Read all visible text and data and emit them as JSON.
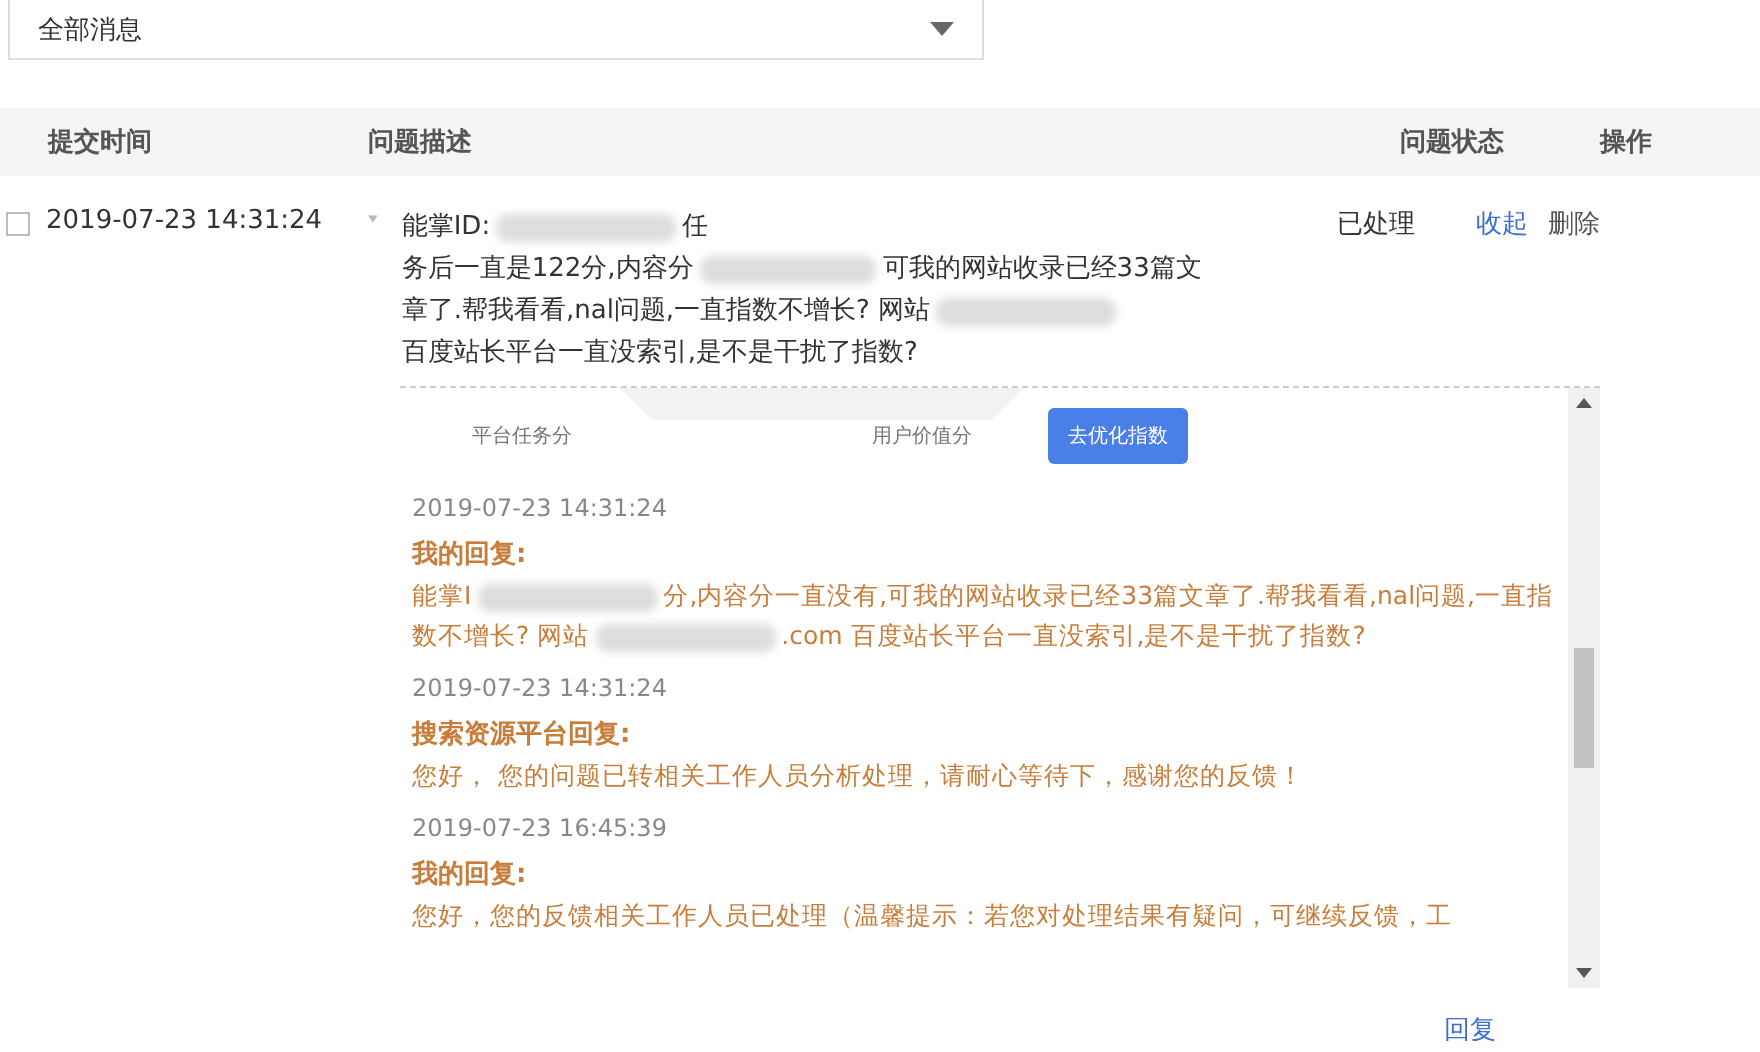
{
  "filter": {
    "value": "全部消息"
  },
  "table": {
    "columns": [
      "提交时间",
      "问题描述",
      "问题状态",
      "操作"
    ],
    "rows": [
      {
        "checked": false,
        "expanded": true,
        "time": "2019-07-23 14:31:24",
        "status": "已处理",
        "actions": [
          {
            "label": "收起",
            "kind": "link"
          },
          {
            "label": "删除",
            "kind": "plain"
          }
        ],
        "description": [
          [
            {
              "kind": "text",
              "text": "能掌ID:"
            },
            {
              "kind": "redacted"
            },
            {
              "kind": "text",
              "text": "任"
            }
          ],
          [
            {
              "kind": "text",
              "text": "务后一直是122分,内容分"
            },
            {
              "kind": "redacted"
            },
            {
              "kind": "text",
              "text": "可我的网站收录已经33篇文"
            }
          ],
          [
            {
              "kind": "text",
              "text": "章了.帮我看看,nal问题,一直指数不增长? 网站"
            },
            {
              "kind": "redacted"
            }
          ],
          [
            {
              "kind": "text",
              "text": "百度站长平台一直没索引,是不是干扰了指数?"
            }
          ]
        ],
        "thread": {
          "image_labels": [
            "平台任务分",
            "用户价值分"
          ],
          "image_button": "去优化指数",
          "entries": [
            {
              "kind": "time",
              "text": "2019-07-23 14:31:24"
            },
            {
              "kind": "author",
              "text": "我的回复:"
            },
            {
              "kind": "message",
              "parts": [
                {
                  "kind": "text",
                  "text": "能掌I"
                },
                {
                  "kind": "redacted"
                },
                {
                  "kind": "text",
                  "text": "分,内容分一直没有,可我的网站收录已经33篇文章了.帮我看看,nal问题,一直指数不增长? 网站"
                },
                {
                  "kind": "redacted"
                },
                {
                  "kind": "text",
                  "text": ".com 百度站长平台一直没索引,是不是干扰了指数?"
                }
              ]
            },
            {
              "kind": "time",
              "text": "2019-07-23 14:31:24"
            },
            {
              "kind": "author",
              "text": "搜索资源平台回复:"
            },
            {
              "kind": "message",
              "parts": [
                {
                  "kind": "text",
                  "text": "您好， 您的问题已转相关工作人员分析处理，请耐心等待下，感谢您的反馈！"
                }
              ]
            },
            {
              "kind": "time",
              "text": "2019-07-23 16:45:39"
            },
            {
              "kind": "author",
              "text": "我的回复:"
            },
            {
              "kind": "message",
              "parts": [
                {
                  "kind": "text",
                  "text": "您好，您的反馈相关工作人员已处理（温馨提示：若您对处理结果有疑问，可继续反馈，工"
                }
              ]
            }
          ]
        },
        "reply_link": "回复"
      }
    ]
  }
}
